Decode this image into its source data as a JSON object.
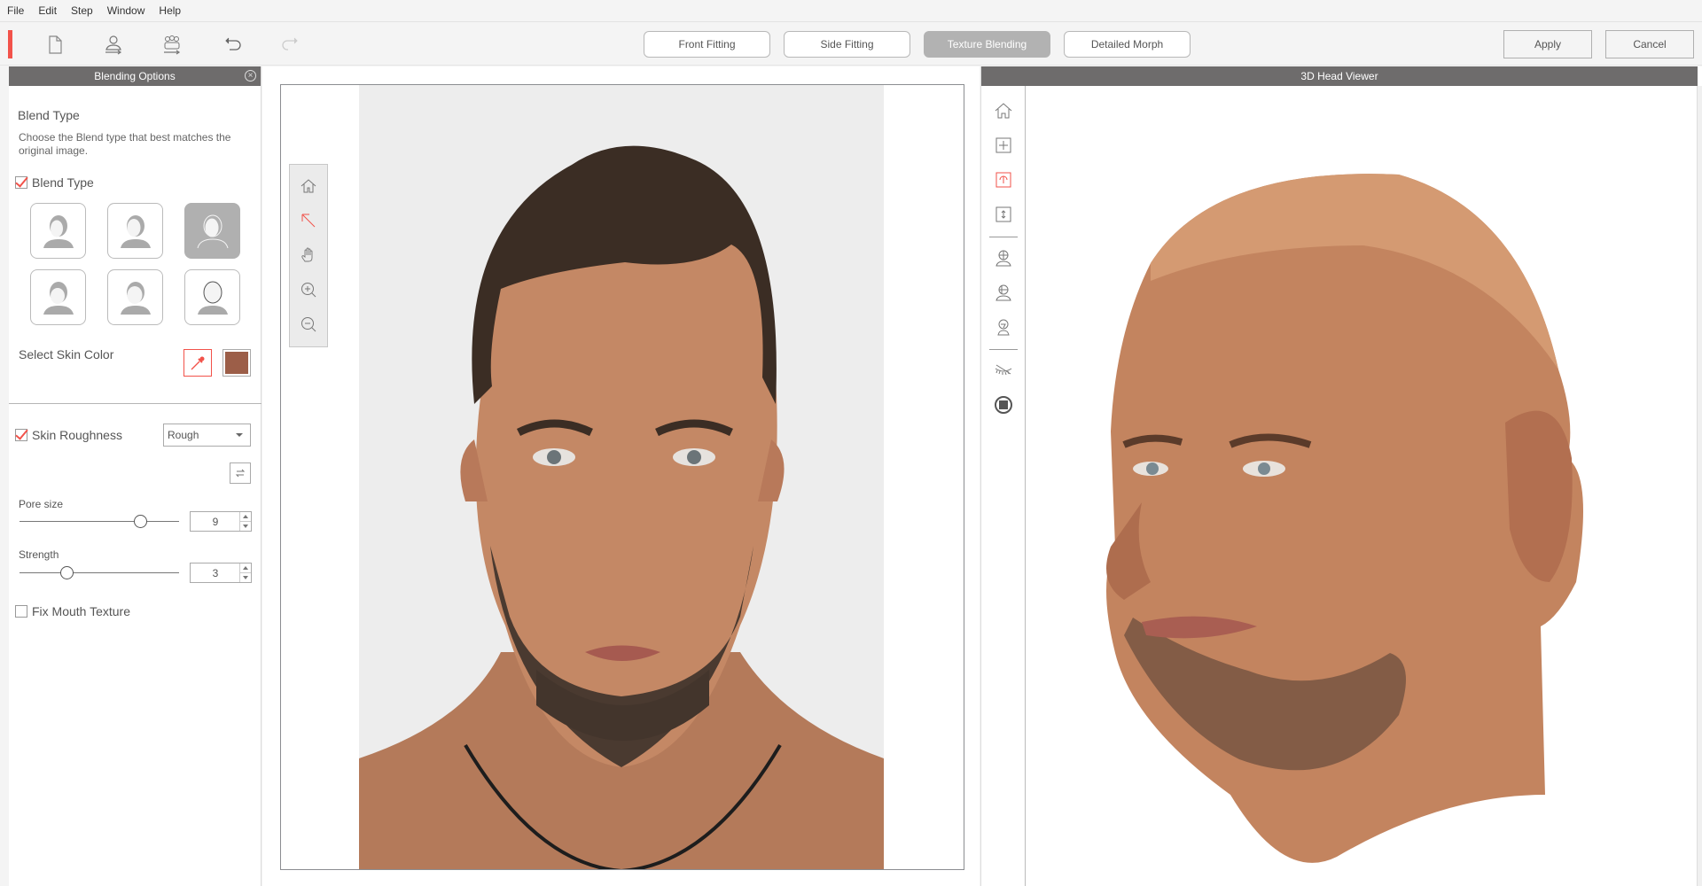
{
  "menu": [
    "File",
    "Edit",
    "Step",
    "Window",
    "Help"
  ],
  "toolbar": {
    "icons": [
      "new-file-icon",
      "import-front-photo-icon",
      "import-group-photo-icon",
      "undo-icon",
      "redo-icon"
    ],
    "steps": [
      {
        "label": "Front Fitting",
        "active": false
      },
      {
        "label": "Side Fitting",
        "active": false
      },
      {
        "label": "Texture Blending",
        "active": true
      },
      {
        "label": "Detailed Morph",
        "active": false
      }
    ],
    "apply_label": "Apply",
    "cancel_label": "Cancel",
    "accent_color": "#f2524a"
  },
  "blending_options": {
    "title": "Blending Options",
    "section_title": "Blend Type",
    "description": "Choose the Blend type that best matches the original image.",
    "blend_type_checkbox": {
      "label": "Blend Type",
      "checked": true
    },
    "blend_types": [
      {
        "name": "blend-type-1",
        "selected": false
      },
      {
        "name": "blend-type-2",
        "selected": false
      },
      {
        "name": "blend-type-3",
        "selected": true
      },
      {
        "name": "blend-type-4",
        "selected": false
      },
      {
        "name": "blend-type-5",
        "selected": false
      },
      {
        "name": "blend-type-6",
        "selected": false
      }
    ],
    "skin_color": {
      "label": "Select Skin Color",
      "color": "#9c5e48"
    },
    "skin_roughness": {
      "label": "Skin Roughness",
      "checked": true,
      "value": "Rough"
    },
    "pore_size": {
      "label": "Pore size",
      "value": "9",
      "fraction": 0.78
    },
    "strength": {
      "label": "Strength",
      "value": "3",
      "fraction": 0.28
    },
    "fix_mouth": {
      "label": "Fix Mouth Texture",
      "checked": false
    }
  },
  "viewer": {
    "title": "3D Head Viewer",
    "photo_tools": [
      "home-icon",
      "select-arrow-icon",
      "pan-hand-icon",
      "zoom-in-icon",
      "zoom-out-icon"
    ],
    "side_tools": [
      "home-icon",
      "move-icon",
      "rotate-icon",
      "zoom-vertical-icon",
      "front-view-icon",
      "three-quarter-view-icon",
      "side-view-icon",
      "eyelashes-icon",
      "wireframe-toggle-icon"
    ]
  }
}
